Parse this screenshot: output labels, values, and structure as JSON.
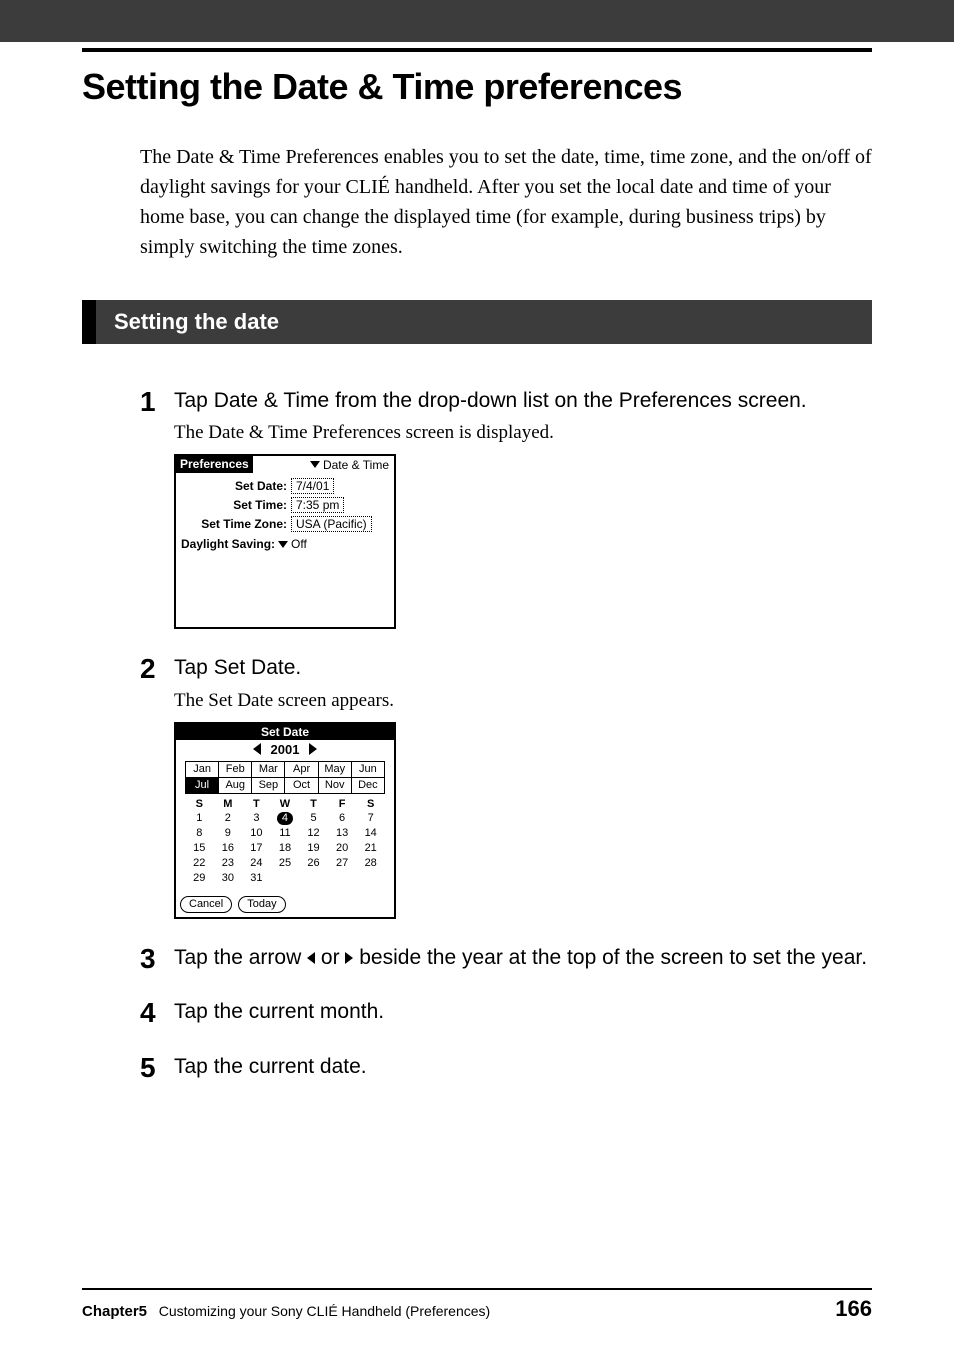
{
  "title": "Setting the Date & Time preferences",
  "intro": "The Date & Time Preferences enables you to set the date, time, time zone, and the on/off of daylight savings for your CLIÉ handheld. After you set the local date and time of your home base, you can change the displayed time (for example, during business trips) by simply switching the time zones.",
  "section_heading": "Setting the date",
  "steps": {
    "s1": {
      "num": "1",
      "main": "Tap Date & Time from the drop-down list on the Preferences screen.",
      "sub": "The Date & Time Preferences screen is displayed."
    },
    "s2": {
      "num": "2",
      "main": "Tap Set Date.",
      "sub": "The Set Date screen appears."
    },
    "s3": {
      "num": "3",
      "main_a": "Tap the arrow ",
      "main_b": " or ",
      "main_c": " beside the year at the top of the screen to set the year.",
      "arrow_left": "V",
      "arrow_right": "B"
    },
    "s4": {
      "num": "4",
      "main": "Tap the current month."
    },
    "s5": {
      "num": "5",
      "main": "Tap the current date."
    }
  },
  "palm_prefs": {
    "header_title": "Preferences",
    "header_dropdown": "Date & Time",
    "rows": {
      "date": {
        "label": "Set Date:",
        "value": "7/4/01"
      },
      "time": {
        "label": "Set Time:",
        "value": "7:35 pm"
      },
      "tz": {
        "label": "Set Time Zone:",
        "value": "USA (Pacific)"
      }
    },
    "ds_label": "Daylight Saving:",
    "ds_value": "Off"
  },
  "palm_setdate": {
    "title": "Set Date",
    "year": "2001",
    "months_r1": [
      "Jan",
      "Feb",
      "Mar",
      "Apr",
      "May",
      "Jun"
    ],
    "months_r2": [
      "Jul",
      "Aug",
      "Sep",
      "Oct",
      "Nov",
      "Dec"
    ],
    "selected_month_index": 6,
    "dow": [
      "S",
      "M",
      "T",
      "W",
      "T",
      "F",
      "S"
    ],
    "weeks": [
      [
        "1",
        "2",
        "3",
        "4",
        "5",
        "6",
        "7"
      ],
      [
        "8",
        "9",
        "10",
        "11",
        "12",
        "13",
        "14"
      ],
      [
        "15",
        "16",
        "17",
        "18",
        "19",
        "20",
        "21"
      ],
      [
        "22",
        "23",
        "24",
        "25",
        "26",
        "27",
        "28"
      ],
      [
        "29",
        "30",
        "31",
        "",
        "",
        "",
        ""
      ]
    ],
    "selected_day": "4",
    "btn_cancel": "Cancel",
    "btn_today": "Today"
  },
  "footer": {
    "chapter_label": "Chapter5",
    "chapter_text": "Customizing your Sony CLIÉ Handheld (Preferences)",
    "page": "166"
  }
}
